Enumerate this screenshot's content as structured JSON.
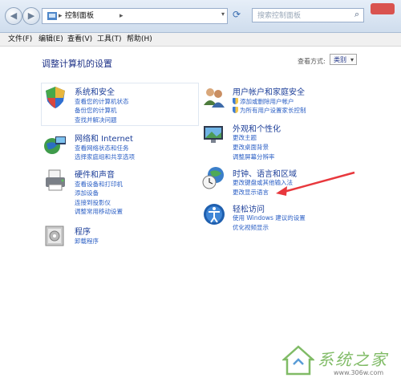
{
  "address": {
    "path": "控制面板",
    "separator": "▸"
  },
  "search": {
    "placeholder": "搜索控制面板"
  },
  "menu": {
    "file": "文件(F)",
    "edit": "编辑(E)",
    "view": "查看(V)",
    "tools": "工具(T)",
    "help": "帮助(H)"
  },
  "page": {
    "title": "调整计算机的设置",
    "view_by_label": "查看方式:",
    "view_by_value": "类别"
  },
  "categories": {
    "system": {
      "title": "系统和安全",
      "links": [
        "查看您的计算机状态",
        "备份您的计算机",
        "查找并解决问题"
      ]
    },
    "network": {
      "title": "网络和 Internet",
      "links": [
        "查看网络状态和任务",
        "选择家庭组和共享选项"
      ]
    },
    "hardware": {
      "title": "硬件和声音",
      "links": [
        "查看设备和打印机",
        "添加设备",
        "连接到投影仪",
        "调整常用移动设置"
      ]
    },
    "programs": {
      "title": "程序",
      "links": [
        "卸载程序"
      ]
    },
    "users": {
      "title": "用户帐户和家庭安全",
      "links": [
        "添加或删除用户帐户",
        "为所有用户设置家长控制"
      ]
    },
    "appearance": {
      "title": "外观和个性化",
      "links": [
        "更改主题",
        "更改桌面背景",
        "调整屏幕分辨率"
      ]
    },
    "clock": {
      "title": "时钟、语言和区域",
      "links": [
        "更改键盘或其他输入法",
        "更改显示语言"
      ]
    },
    "ease": {
      "title": "轻松访问",
      "links": [
        "使用 Windows 建议的设置",
        "优化视频显示"
      ]
    }
  },
  "watermark": {
    "text": "系统之家",
    "url": "www.306w.com"
  },
  "colors": {
    "link": "#2b5fc5",
    "title": "#1d3f99",
    "arrow": "#e8383d"
  }
}
